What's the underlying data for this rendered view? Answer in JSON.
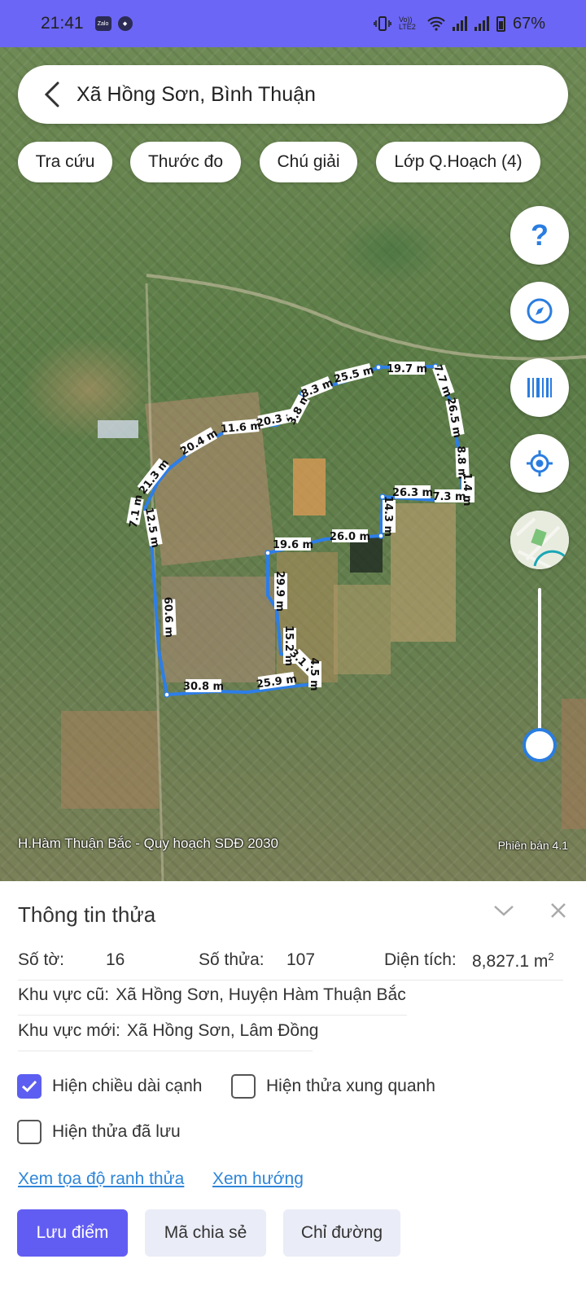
{
  "status_bar": {
    "time": "21:41",
    "app_icons": [
      "zalo-icon",
      "flame-icon"
    ],
    "network_label": "Vo)) LTE2",
    "battery": "67%"
  },
  "search": {
    "title": "Xã Hồng Sơn, Bình Thuận"
  },
  "chips": [
    "Tra cứu",
    "Thước đo",
    "Chú giải",
    "Lớp Q.Hoạch (4)"
  ],
  "map_controls": {
    "buttons": [
      "help-icon",
      "compass-icon",
      "barcode-icon",
      "locate-icon",
      "minimap-icon"
    ],
    "zoom_level_fraction": 1.0
  },
  "map": {
    "caption": "H.Hàm Thuận Bắc - Quy hoạch SDĐ 2030",
    "version": "Phiên bản 4.1",
    "edge_labels": [
      "19.7 m",
      "7.7 m",
      "26.5 m",
      "8.8 m",
      "1.4 m",
      "7.3 m",
      "26.3 m",
      "14.3 m",
      "26.0 m",
      "19.6 m",
      "29.9 m",
      "15.2 m",
      "3.1 m",
      "4.5 m",
      "25.9 m",
      "30.8 m",
      "60.6 m",
      "12.5 m",
      "7.1 m",
      "21.3 m",
      "20.4 m",
      "11.6 m",
      "20.3 m",
      "3.8 m",
      "8.3 m",
      "25.5 m"
    ],
    "boundary_color": "#2d7ee8"
  },
  "sheet": {
    "title": "Thông tin thửa",
    "so_to_label": "Số tờ:",
    "so_to_value": "16",
    "so_thua_label": "Số thửa:",
    "so_thua_value": "107",
    "dien_tich_label": "Diện tích:",
    "dien_tich_value": "8,827.1 m",
    "dien_tich_sup": "2",
    "khu_vuc_cu_label": "Khu vực cũ:",
    "khu_vuc_cu_value": "Xã Hồng Sơn, Huyện Hàm Thuận Bắc",
    "khu_vuc_moi_label": "Khu vực mới:",
    "khu_vuc_moi_value": "Xã Hồng Sơn, Lâm Đồng",
    "checkboxes": [
      {
        "label": "Hiện chiều dài cạnh",
        "checked": true
      },
      {
        "label": "Hiện thửa xung quanh",
        "checked": false
      },
      {
        "label": "Hiện thửa đã lưu",
        "checked": false
      }
    ],
    "links": [
      "Xem tọa độ ranh thửa",
      "Xem hướng"
    ],
    "buttons": [
      "Lưu điểm",
      "Mã chia sẻ",
      "Chỉ đường"
    ]
  }
}
